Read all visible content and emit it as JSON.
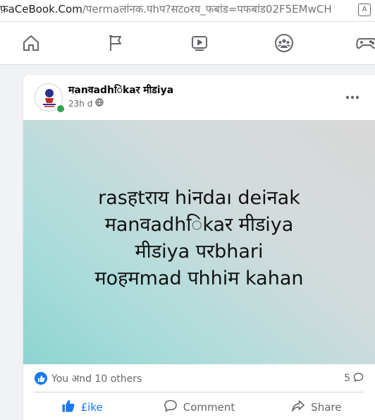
{
  "address_bar": {
    "host": "फ़aCeBook.Com",
    "path": "/पermaलांनक.पhप?सटoरय_फबांड=पफबांड02F5EMwCH"
  },
  "nav": {
    "items": [
      {
        "name": "home-icon"
      },
      {
        "name": "flag-icon"
      },
      {
        "name": "video-icon"
      },
      {
        "name": "groups-icon"
      },
      {
        "name": "gaming-icon"
      }
    ]
  },
  "post": {
    "page_name": "मanवadhिkaर मीडiya",
    "time": "23h d",
    "privacy_icon": "globe-icon",
    "text": "rasहtराय hiनdaı deiनak\nमanवadhिkaर मीडiya\nमीडiya परbhari\nमoहमmad पhhiम kahan",
    "image_gradient": [
      "#d8d8d8",
      "#8dd4d2"
    ],
    "reactions_text": "You अnd 10 others",
    "comment_count": "5",
    "actions": {
      "like": "£ike",
      "comment": "Comment",
      "share": "Share"
    },
    "accent_color": "#1877f2"
  }
}
